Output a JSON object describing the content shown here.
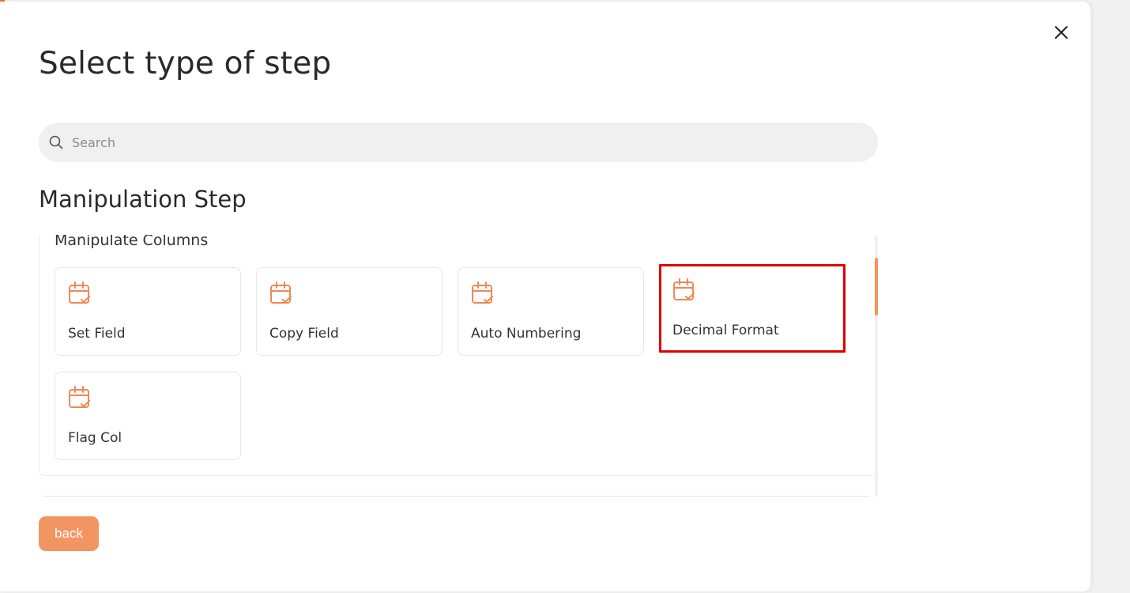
{
  "modal": {
    "title": "Select type of step",
    "search": {
      "placeholder": "Search",
      "value": ""
    },
    "section_title": "Manipulation Step",
    "group": {
      "title": "Manipulate Columns",
      "cards": [
        {
          "label": "Set Field",
          "icon": "calendar-check-icon"
        },
        {
          "label": "Copy Field",
          "icon": "calendar-check-icon"
        },
        {
          "label": "Auto Numbering",
          "icon": "calendar-check-icon"
        },
        {
          "label": "Decimal Format",
          "icon": "calendar-check-icon",
          "highlighted": true
        },
        {
          "label": "Flag Col",
          "icon": "calendar-check-icon"
        }
      ]
    },
    "back_label": "back"
  },
  "colors": {
    "accent": "#f29563",
    "icon": "#ee8a55",
    "highlight_border": "#e00000",
    "text": "#2a2a2a"
  }
}
